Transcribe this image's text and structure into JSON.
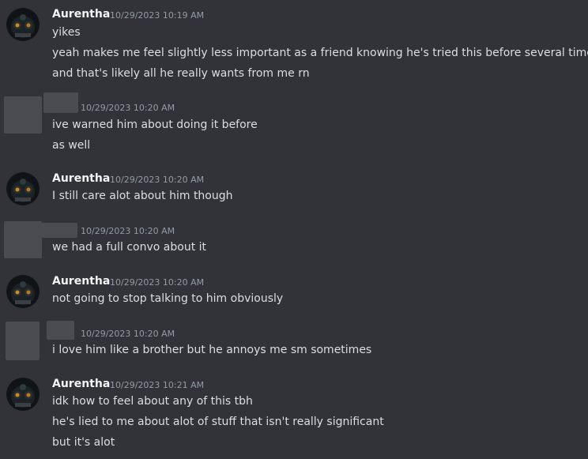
{
  "messages": [
    {
      "author": "Aurentha",
      "timestamp": "10/29/2023 10:19 AM",
      "lines": [
        "yikes",
        "yeah makes me feel slightly less important as a friend knowing he's tried this before several times",
        "and that's likely all he really wants from me rn"
      ]
    },
    {
      "author": "",
      "timestamp": "10/29/2023 10:20 AM",
      "lines": [
        "ive warned him about doing it before",
        "as well"
      ]
    },
    {
      "author": "Aurentha",
      "timestamp": "10/29/2023 10:20 AM",
      "lines": [
        "I still care alot about him though"
      ]
    },
    {
      "author": "",
      "timestamp": "10/29/2023 10:20 AM",
      "lines": [
        "we had a full convo about it"
      ]
    },
    {
      "author": "Aurentha",
      "timestamp": "10/29/2023 10:20 AM",
      "lines": [
        "not going to stop talking to him obviously"
      ]
    },
    {
      "author": "",
      "timestamp": "10/29/2023 10:20 AM",
      "lines": [
        "i love him like a brother but he annoys me sm sometimes"
      ]
    },
    {
      "author": "Aurentha",
      "timestamp": "10/29/2023 10:21 AM",
      "lines": [
        "idk how to feel about any of this tbh",
        "he's lied to me about alot of stuff that isn't really significant",
        "but it's alot"
      ]
    }
  ],
  "colors": {
    "background": "#313338",
    "text": "#dbdee1",
    "author": "#f2f3f5",
    "timestamp": "#949ba4",
    "redacted": "#4a4c52"
  },
  "icons": {
    "avatar_aurentha": "robot-avatar-icon",
    "avatar_redacted": "redacted-avatar"
  }
}
